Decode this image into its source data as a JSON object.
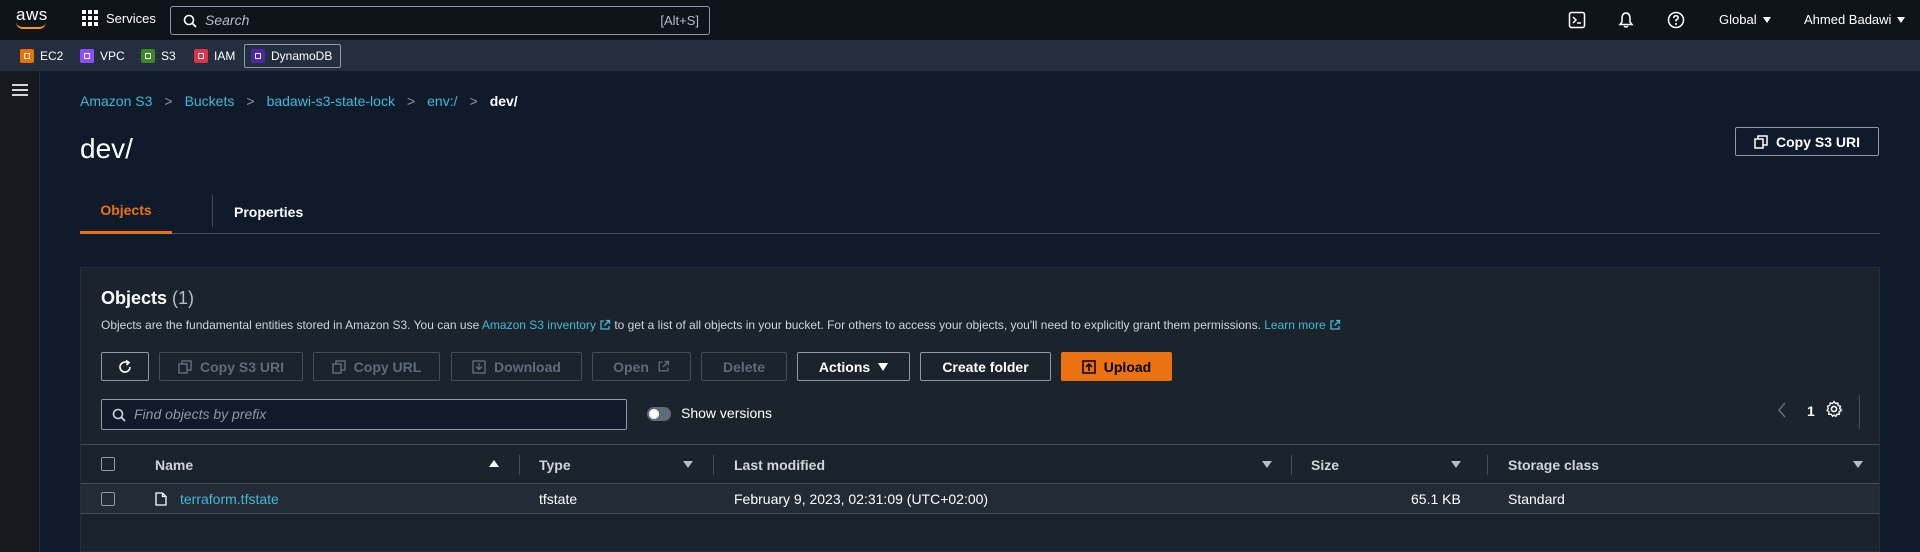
{
  "topnav": {
    "logo_text": "aws",
    "services_label": "Services",
    "search_placeholder": "Search",
    "search_shortcut": "[Alt+S]",
    "region_label": "Global",
    "user_label": "Ahmed Badawi"
  },
  "favorites": [
    {
      "label": "EC2",
      "color": "#ed7100"
    },
    {
      "label": "VPC",
      "color": "#8c4fff"
    },
    {
      "label": "S3",
      "color": "#3f8624"
    },
    {
      "label": "IAM",
      "color": "#dd344c"
    },
    {
      "label": "DynamoDB",
      "color": "#4d27aa"
    }
  ],
  "breadcrumb": {
    "items": [
      "Amazon S3",
      "Buckets",
      "badawi-s3-state-lock",
      "env:/"
    ],
    "current": "dev/"
  },
  "page": {
    "title": "dev/",
    "copy_uri_label": "Copy S3 URI"
  },
  "tabs": [
    {
      "label": "Objects",
      "active": true
    },
    {
      "label": "Properties",
      "active": false
    }
  ],
  "objects_panel": {
    "title": "Objects",
    "count": "(1)",
    "desc_part1": "Objects are the fundamental entities stored in Amazon S3. You can use ",
    "desc_link1": "Amazon S3 inventory",
    "desc_part2": " to get a list of all objects in your bucket. For others to access your objects, you'll need to explicitly grant them permissions. ",
    "desc_link2": "Learn more",
    "buttons": {
      "copy_uri": "Copy S3 URI",
      "copy_url": "Copy URL",
      "download": "Download",
      "open": "Open",
      "delete": "Delete",
      "actions": "Actions",
      "create_folder": "Create folder",
      "upload": "Upload"
    },
    "filter_placeholder": "Find objects by prefix",
    "show_versions_label": "Show versions",
    "show_versions_on": false,
    "page_number": "1"
  },
  "table": {
    "columns": [
      "Name",
      "Type",
      "Last modified",
      "Size",
      "Storage class"
    ],
    "rows": [
      {
        "name": "terraform.tfstate",
        "type": "tfstate",
        "last_modified": "February 9, 2023, 02:31:09 (UTC+02:00)",
        "size": "65.1 KB",
        "storage_class": "Standard"
      }
    ]
  },
  "colors": {
    "accent": "#ec7211",
    "link": "#44b9d6",
    "nav_bg": "#0f141a",
    "fav_bg": "#232f3e",
    "page_bg": "#0f1b2a"
  }
}
